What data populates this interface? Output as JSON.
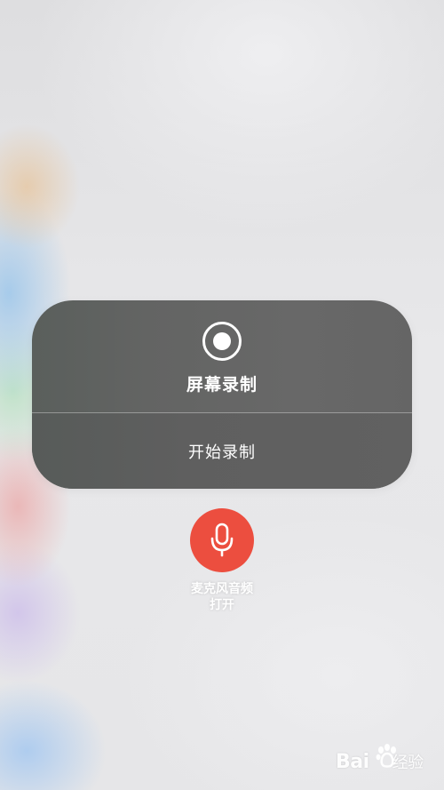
{
  "screen_recording": {
    "title": "屏幕录制",
    "start_label": "开始录制",
    "icon": "record-icon"
  },
  "microphone": {
    "label": "麦克风音频",
    "status": "打开",
    "icon": "microphone-icon",
    "color": "#ec4e3f"
  },
  "watermark": {
    "text": "Bai",
    "suffix": "经验",
    "icon": "paw-icon"
  }
}
